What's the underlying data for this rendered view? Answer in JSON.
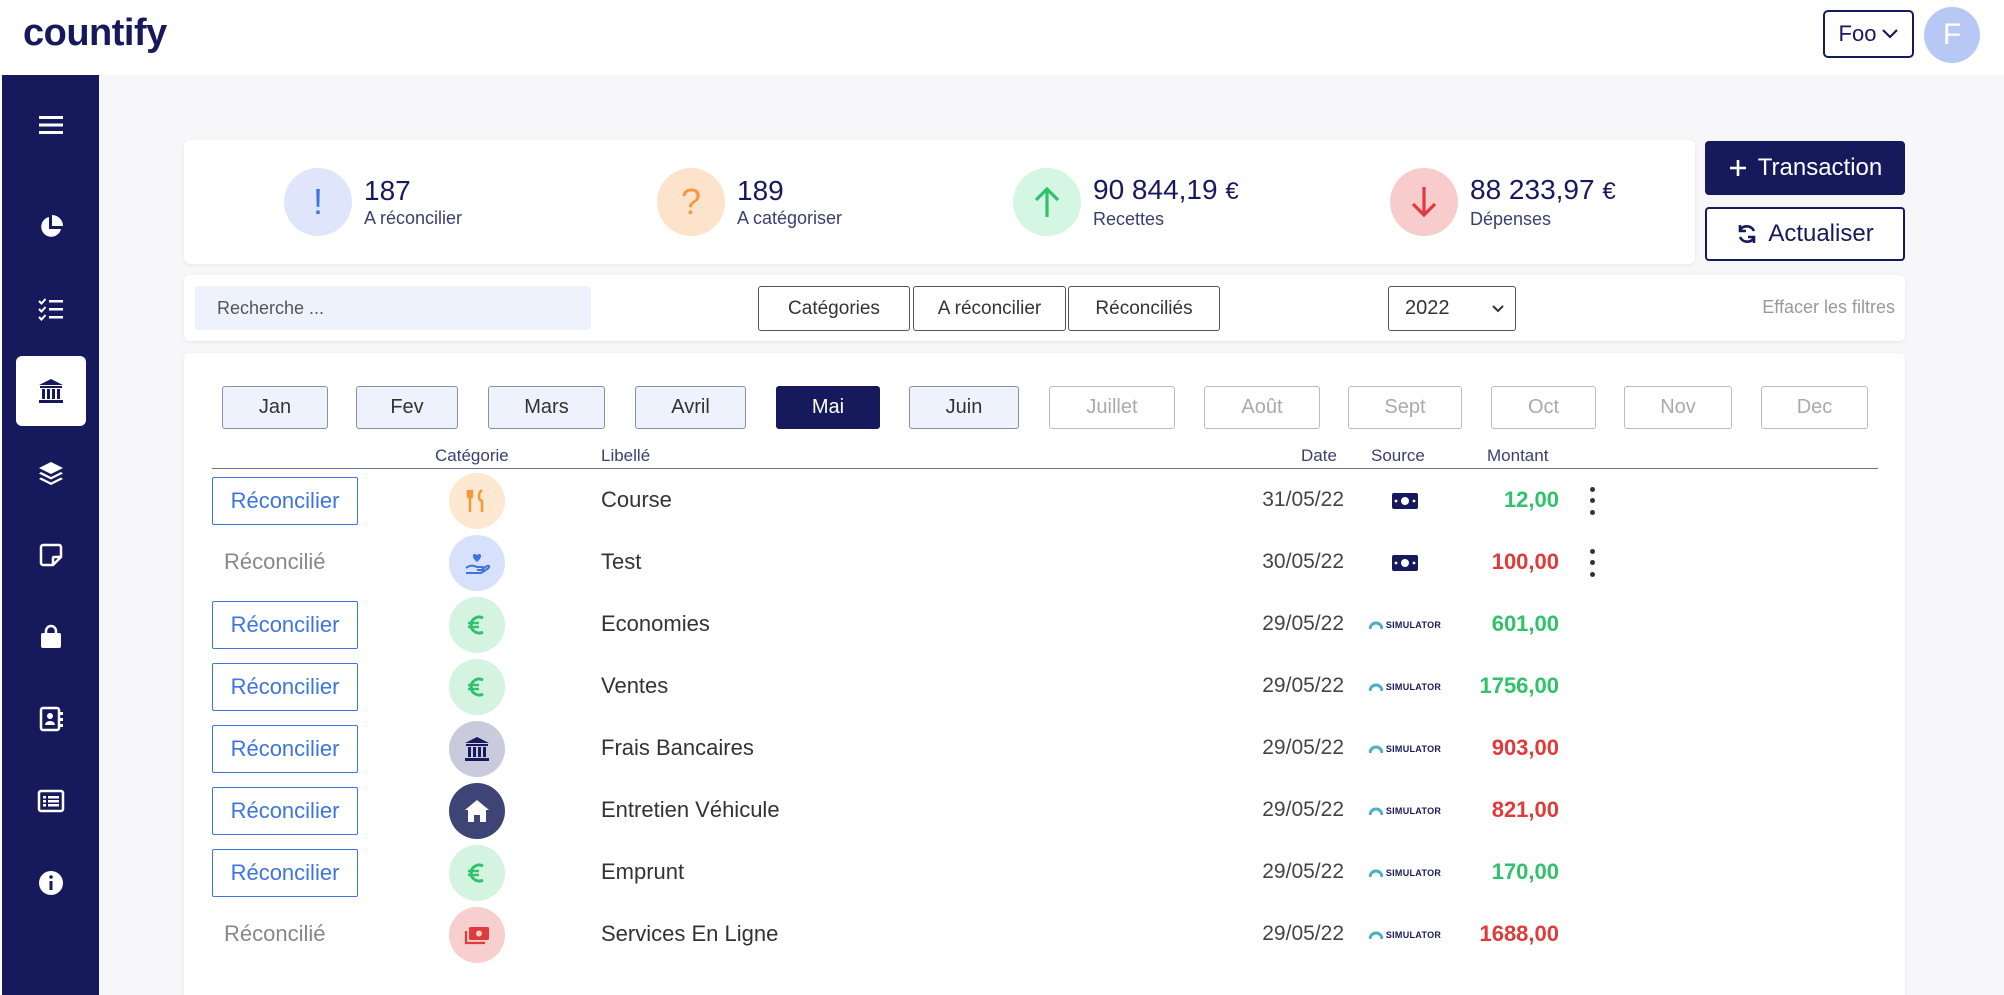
{
  "app": {
    "logo": "countify"
  },
  "header": {
    "org_label": "Foo",
    "avatar_initial": "F"
  },
  "sidebar": {
    "items": [
      {
        "name": "menu",
        "icon": "hamburger-icon"
      },
      {
        "name": "dashboard",
        "icon": "pie-chart-icon"
      },
      {
        "name": "tasks",
        "icon": "checklist-icon"
      },
      {
        "name": "bank",
        "icon": "bank-icon",
        "active": true
      },
      {
        "name": "layers",
        "icon": "layers-icon"
      },
      {
        "name": "notes",
        "icon": "note-icon"
      },
      {
        "name": "shop",
        "icon": "shopping-bag-icon"
      },
      {
        "name": "contacts",
        "icon": "contact-book-icon"
      },
      {
        "name": "list",
        "icon": "list-icon"
      },
      {
        "name": "info",
        "icon": "info-icon"
      }
    ]
  },
  "stats": [
    {
      "glyph": "!",
      "value": "187",
      "unit": "",
      "label": "A réconcilier",
      "bg": "#dfe6fb",
      "fg": "#3c74e0"
    },
    {
      "glyph": "?",
      "value": "189",
      "unit": "",
      "label": "A catégoriser",
      "bg": "#fde3cc",
      "fg": "#f29a3a"
    },
    {
      "glyph": "↑",
      "value": "90 844,19",
      "unit": "€",
      "label": "Recettes",
      "bg": "#d4f6e2",
      "fg": "#2ec26a"
    },
    {
      "glyph": "↓",
      "value": "88 233,97",
      "unit": "€",
      "label": "Dépenses",
      "bg": "#f8cccc",
      "fg": "#e03a3a"
    }
  ],
  "actions": {
    "transaction_label": "Transaction",
    "refresh_label": "Actualiser"
  },
  "filters": {
    "search_placeholder": "Recherche ...",
    "buttons": [
      "Catégories",
      "A réconcilier",
      "Réconciliés"
    ],
    "year": "2022",
    "clear_label": "Effacer les filtres"
  },
  "months": [
    {
      "label": "Jan",
      "state": "avail"
    },
    {
      "label": "Fev",
      "state": "avail"
    },
    {
      "label": "Mars",
      "state": "avail"
    },
    {
      "label": "Avril",
      "state": "avail"
    },
    {
      "label": "Mai",
      "state": "sel"
    },
    {
      "label": "Juin",
      "state": "avail"
    },
    {
      "label": "Juillet",
      "state": "dis"
    },
    {
      "label": "Août",
      "state": "dis"
    },
    {
      "label": "Sept",
      "state": "dis"
    },
    {
      "label": "Oct",
      "state": "dis"
    },
    {
      "label": "Nov",
      "state": "dis"
    },
    {
      "label": "Dec",
      "state": "dis"
    }
  ],
  "table": {
    "headers": {
      "category": "Catégorie",
      "label": "Libellé",
      "date": "Date",
      "source": "Source",
      "amount": "Montant"
    },
    "rows": [
      {
        "status": "Réconcilier",
        "reconciled": false,
        "cat_icon": "fork-knife-icon",
        "cat_bg": "#fde8d2",
        "cat_fg": "#f29a3a",
        "label": "Course",
        "date": "31/05/22",
        "source": "cash-icon",
        "amount": "12,00",
        "sign": "pos",
        "menu": true
      },
      {
        "status": "Réconcilié",
        "reconciled": true,
        "cat_icon": "hand-heart-icon",
        "cat_bg": "#d8e1fb",
        "cat_fg": "#3c74e0",
        "label": "Test",
        "date": "30/05/22",
        "source": "cash-icon",
        "amount": "100,00",
        "sign": "neg",
        "menu": true
      },
      {
        "status": "Réconcilier",
        "reconciled": false,
        "cat_icon": "euro-icon",
        "cat_bg": "#d4f3e0",
        "cat_fg": "#2ec26a",
        "label": "Economies",
        "date": "29/05/22",
        "source": "simulator-logo",
        "source_text": "SIMULATOR",
        "amount": "601,00",
        "sign": "pos",
        "menu": false
      },
      {
        "status": "Réconcilier",
        "reconciled": false,
        "cat_icon": "euro-icon",
        "cat_bg": "#d4f3e0",
        "cat_fg": "#2ec26a",
        "label": "Ventes",
        "date": "29/05/22",
        "source": "simulator-logo",
        "source_text": "SIMULATOR",
        "amount": "1756,00",
        "sign": "pos",
        "menu": false
      },
      {
        "status": "Réconcilier",
        "reconciled": false,
        "cat_icon": "bank-icon",
        "cat_bg": "#c9cbdc",
        "cat_fg": "#161a5c",
        "label": "Frais Bancaires",
        "date": "29/05/22",
        "source": "simulator-logo",
        "source_text": "SIMULATOR",
        "amount": "903,00",
        "sign": "neg",
        "menu": false
      },
      {
        "status": "Réconcilier",
        "reconciled": false,
        "cat_icon": "house-icon",
        "cat_bg": "#3f4477",
        "cat_fg": "#ffffff",
        "label": "Entretien Véhicule",
        "date": "29/05/22",
        "source": "simulator-logo",
        "source_text": "SIMULATOR",
        "amount": "821,00",
        "sign": "neg",
        "menu": false
      },
      {
        "status": "Réconcilier",
        "reconciled": false,
        "cat_icon": "euro-icon",
        "cat_bg": "#d4f3e0",
        "cat_fg": "#2ec26a",
        "label": "Emprunt",
        "date": "29/05/22",
        "source": "simulator-logo",
        "source_text": "SIMULATOR",
        "amount": "170,00",
        "sign": "pos",
        "menu": false
      },
      {
        "status": "Réconcilié",
        "reconciled": true,
        "cat_icon": "money-stack-icon",
        "cat_bg": "#f8cfcf",
        "cat_fg": "#e03a3a",
        "label": "Services En Ligne",
        "date": "29/05/22",
        "source": "simulator-logo",
        "source_text": "SIMULATOR",
        "amount": "1688,00",
        "sign": "neg",
        "menu": false
      }
    ]
  },
  "colors": {
    "brand": "#161a5c",
    "accent": "#3c74e0",
    "positive": "#2ec26a",
    "negative": "#e03a3a"
  }
}
